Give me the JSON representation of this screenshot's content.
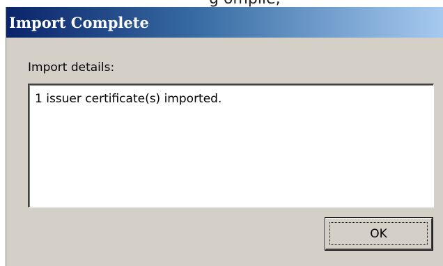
{
  "background_fragment": "g    ompile,",
  "dialog": {
    "title": "Import Complete",
    "details_label": "Import details:",
    "details_text": "1 issuer certificate(s) imported.",
    "ok_label": "OK"
  },
  "colors": {
    "dialog_bg": "#d4d0c8",
    "titlebar_start": "#0a246a",
    "titlebar_end": "#a6caf0",
    "title_text": "#ffffff"
  }
}
